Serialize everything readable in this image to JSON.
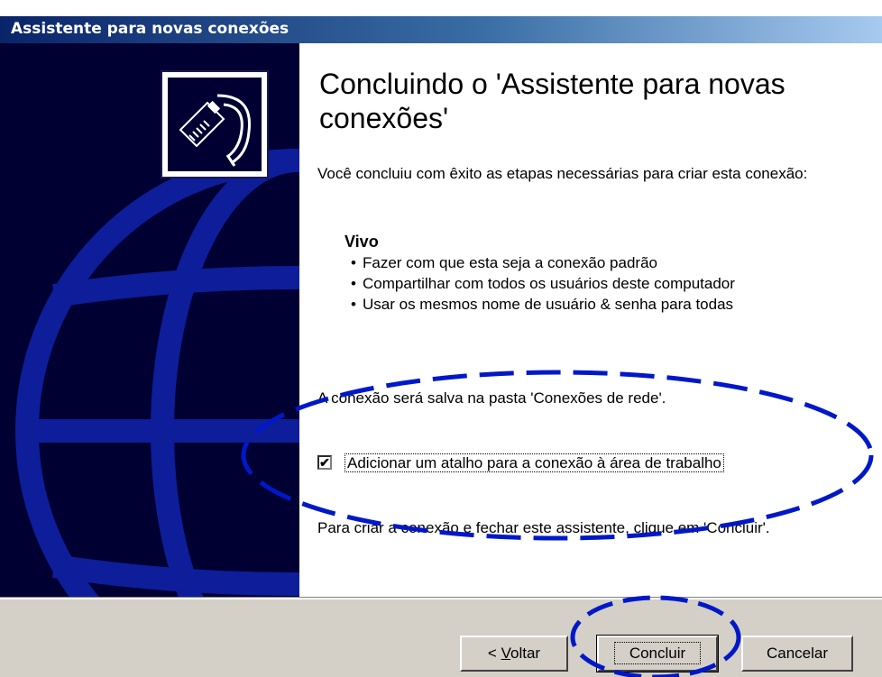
{
  "window": {
    "title": "Assistente para novas conexões"
  },
  "wizard": {
    "icon": "network-cable-icon",
    "background_icon": "globe-icon",
    "heading": "Concluindo o 'Assistente para novas conexões'",
    "intro": "Você concluiu com êxito as etapas necessárias para criar esta conexão:",
    "connection_name": "Vivo",
    "bullet_char": "•",
    "options": [
      "Fazer com que esta seja a conexão padrão",
      "Compartilhar com todos os usuários deste computador",
      "Usar os mesmos nome de usuário & senha para todas"
    ],
    "save_info": "A conexão será salva na pasta 'Conexões de rede'.",
    "shortcut": {
      "label": "Adicionar um atalho para a conexão à área de trabalho",
      "checked": true,
      "check_mark": "✔"
    },
    "finish_info": "Para criar a conexão e fechar este assistente, clique em 'Concluir'."
  },
  "buttons": {
    "back_prefix": "< ",
    "back_mnemonic": "V",
    "back_rest": "oltar",
    "finish": "Concluir",
    "cancel": "Cancelar"
  },
  "colors": {
    "title_bar": "#0a246a",
    "left_panel": "#000033",
    "annotation": "#0018c8",
    "button_face": "#d4d0c8"
  }
}
